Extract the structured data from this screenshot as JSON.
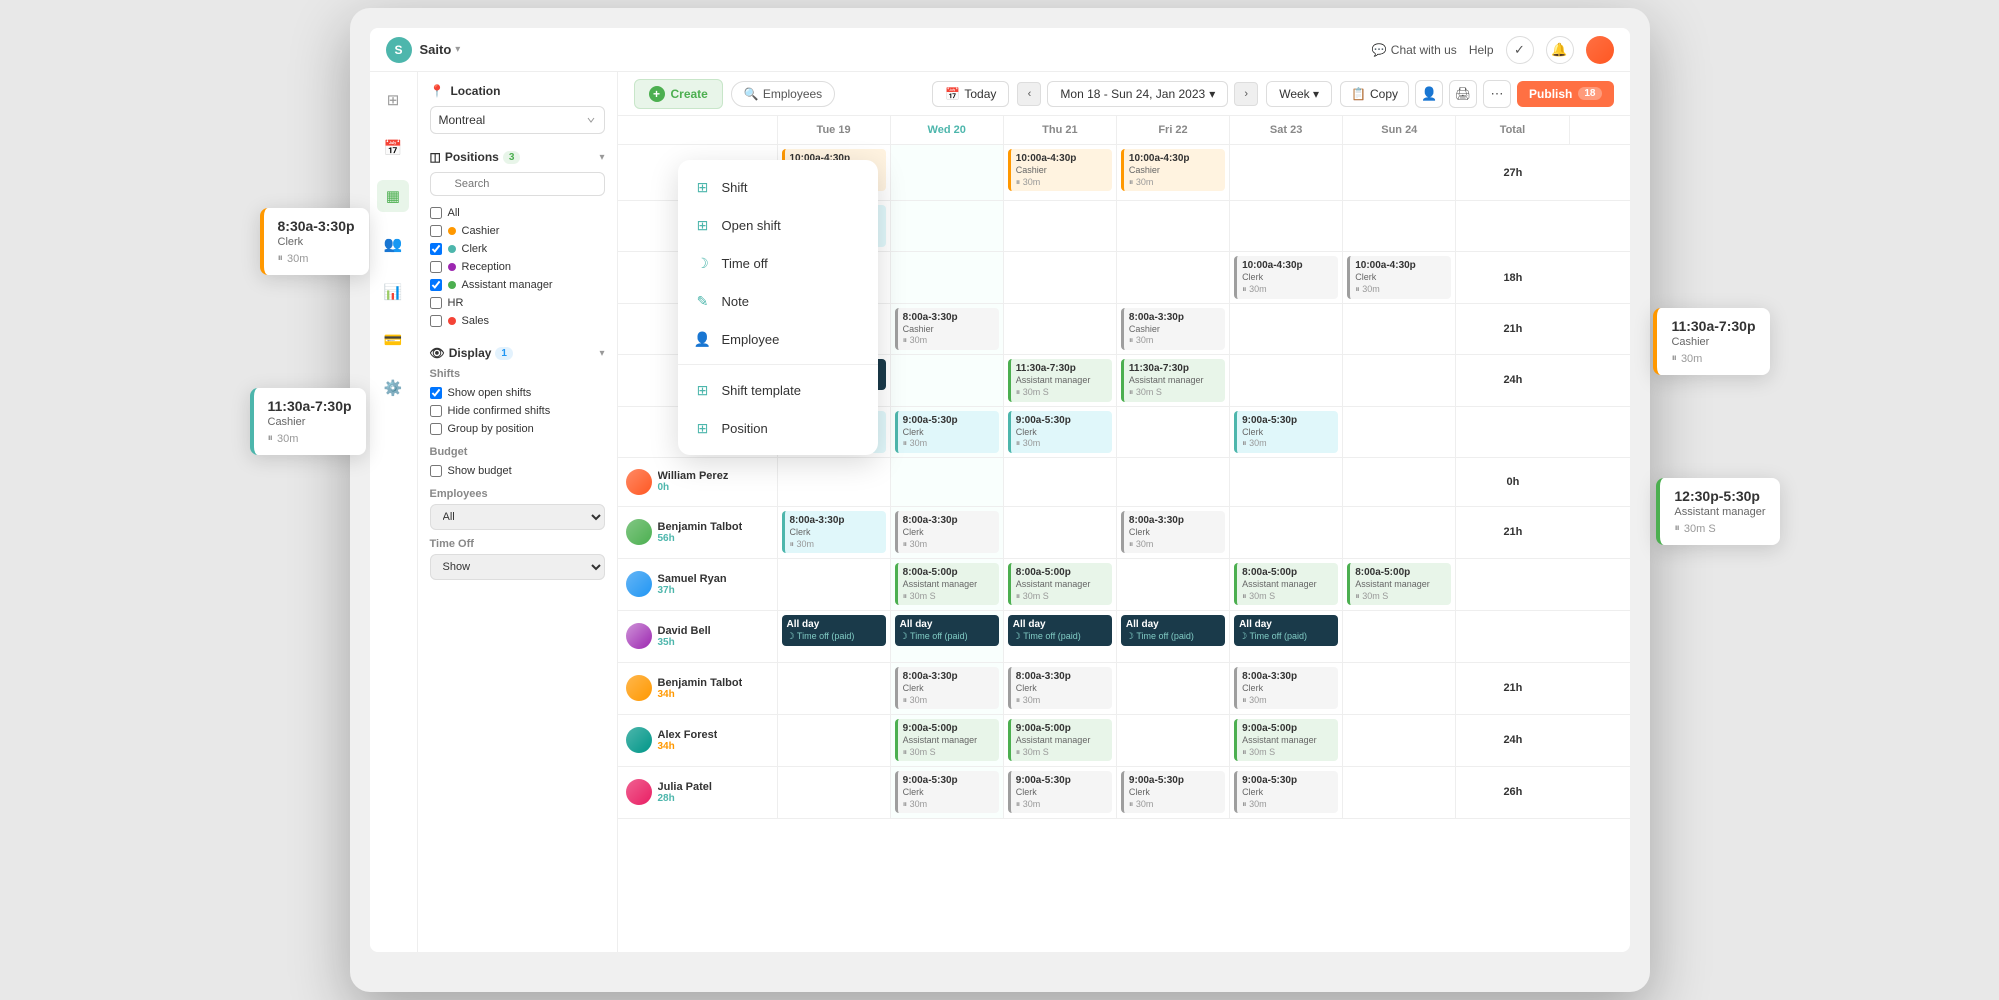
{
  "app": {
    "company": "Saito",
    "logo_letter": "S"
  },
  "topbar": {
    "chat_label": "Chat with us",
    "help_label": "Help"
  },
  "scheduler": {
    "create_label": "Create",
    "employees_filter": "Employees",
    "today_label": "Today",
    "date_range": "Mon 18 - Sun 24, Jan 2023",
    "week_label": "Week",
    "copy_label": "Copy",
    "publish_label": "Publish",
    "publish_count": "18"
  },
  "calendar_headers": [
    "",
    "Tue 19",
    "Wed 20",
    "Thu 21",
    "Fri 22",
    "Sat 23",
    "Sun 24",
    "Total"
  ],
  "dropdown": {
    "items": [
      {
        "icon": "⊞",
        "label": "Shift"
      },
      {
        "icon": "⊞",
        "label": "Open shift"
      },
      {
        "icon": "☽",
        "label": "Time off"
      },
      {
        "icon": "✎",
        "label": "Note"
      },
      {
        "icon": "👤",
        "label": "Employee"
      },
      {
        "divider": true
      },
      {
        "icon": "⊞",
        "label": "Shift template"
      },
      {
        "icon": "⊞",
        "label": "Position"
      }
    ]
  },
  "sidebar": {
    "location_label": "Location",
    "location_value": "Montreal",
    "positions_label": "Positions",
    "positions_badge": "3",
    "search_placeholder": "Search",
    "positions": [
      {
        "label": "All",
        "checked": false,
        "dot": null
      },
      {
        "label": "Cashier",
        "checked": false,
        "dot": "orange"
      },
      {
        "label": "Clerk",
        "checked": true,
        "dot": "teal"
      },
      {
        "label": "Reception",
        "checked": false,
        "dot": "purple"
      },
      {
        "label": "Assistant manager",
        "checked": true,
        "dot": "green"
      },
      {
        "label": "HR",
        "checked": false,
        "dot": null
      },
      {
        "label": "Sales",
        "checked": false,
        "dot": "red"
      }
    ],
    "display_label": "Display",
    "display_badge": "1",
    "shifts_label": "Shifts",
    "show_open_shifts": "Show open shifts",
    "hide_confirmed_shifts": "Hide confirmed shifts",
    "group_by_position": "Group by position",
    "budget_label": "Budget",
    "show_budget": "Show budget",
    "employees_label": "Employees",
    "employees_value": "All",
    "time_off_label": "Time Off",
    "time_off_value": "Show"
  },
  "employees": [
    {
      "name": "William Perez",
      "hours": "0h",
      "avatar": "1",
      "shifts": [
        null,
        null,
        null,
        null,
        null,
        null
      ],
      "total": "0h"
    },
    {
      "name": "Benjamin Talbot",
      "hours": "56h",
      "avatar": "2",
      "shifts": [
        {
          "time": "8:00a-3:30p",
          "role": "Clerk",
          "duration": "30m",
          "type": "teal"
        },
        {
          "time": "8:00a-3:30p",
          "role": "Clerk",
          "duration": "30m",
          "type": "default"
        },
        null,
        {
          "time": "8:00a-3:30p",
          "role": "Clerk",
          "duration": "30m",
          "type": "default"
        },
        null,
        null
      ],
      "total": "21h"
    },
    {
      "name": "Samuel Ryan",
      "hours": "37h",
      "avatar": "3",
      "shifts": [
        null,
        {
          "time": "8:00a-5:00p",
          "role": "Assistant manager",
          "duration": "30m S",
          "type": "default"
        },
        {
          "time": "8:00a-5:00p",
          "role": "Assistant manager",
          "duration": "30m S",
          "type": "default"
        },
        null,
        {
          "time": "8:00a-5:00p",
          "role": "Assistant manager",
          "duration": "30m S",
          "type": "default"
        },
        {
          "time": "8:00a-5:00p",
          "role": "Assistant manager",
          "duration": "30m S",
          "type": "default"
        }
      ],
      "total": ""
    },
    {
      "name": "David Bell",
      "hours": "35h",
      "avatar": "4",
      "shifts": [
        {
          "time": "All day",
          "role": "Time off (paid)",
          "type": "time-off"
        },
        {
          "time": "All day",
          "role": "Time off (paid)",
          "type": "time-off"
        },
        {
          "time": "All day",
          "role": "Time off (paid)",
          "type": "time-off"
        },
        {
          "time": "All day",
          "role": "Time off (paid)",
          "type": "time-off"
        },
        {
          "time": "All day",
          "role": "Time off (paid)",
          "type": "time-off"
        },
        null
      ],
      "total": ""
    },
    {
      "name": "Benjamin Talbot",
      "hours": "34h",
      "avatar": "5",
      "shifts": [
        null,
        {
          "time": "8:00a-3:30p",
          "role": "Clerk",
          "duration": "30m",
          "type": "default"
        },
        {
          "time": "8:00a-3:30p",
          "role": "Clerk",
          "duration": "30m",
          "type": "default"
        },
        null,
        {
          "time": "8:00a-3:30p",
          "role": "Clerk",
          "duration": "30m",
          "type": "default"
        },
        null
      ],
      "total": "21h"
    },
    {
      "name": "Alex Forest",
      "hours": "34h",
      "avatar": "6",
      "shifts": [
        null,
        {
          "time": "9:00a-5:00p",
          "role": "Assistant manager",
          "duration": "30m S",
          "type": "default"
        },
        {
          "time": "9:00a-5:00p",
          "role": "Assistant manager",
          "duration": "30m S",
          "type": "default"
        },
        null,
        {
          "time": "9:00a-5:00p",
          "role": "Assistant manager",
          "duration": "30m S",
          "type": "default"
        },
        null
      ],
      "total": "24h"
    },
    {
      "name": "Julia Patel",
      "hours": "28h",
      "avatar": "7",
      "shifts": [
        null,
        {
          "time": "9:00a-5:30p",
          "role": "Clerk",
          "duration": "30m",
          "type": "default"
        },
        {
          "time": "9:00a-5:30p",
          "role": "Clerk",
          "duration": "30m",
          "type": "default"
        },
        {
          "time": "9:00a-5:30p",
          "role": "Clerk",
          "duration": "30m",
          "type": "default"
        },
        {
          "time": "9:00a-5:30p",
          "role": "Clerk",
          "duration": "30m",
          "type": "default"
        },
        null
      ],
      "total": "26h"
    }
  ],
  "floating_cards": {
    "card1": {
      "time": "8:30a-3:30p",
      "role": "Clerk",
      "duration": "30m"
    },
    "card2": {
      "time": "11:30a-7:30p",
      "role": "Cashier",
      "duration": "30m"
    },
    "card3": {
      "time": "11:30a-7:30p",
      "role": "Cashier",
      "duration": "30m"
    },
    "card4": {
      "time": "12:30p-5:30p",
      "role": "Assistant manager",
      "duration": "30m S"
    }
  }
}
